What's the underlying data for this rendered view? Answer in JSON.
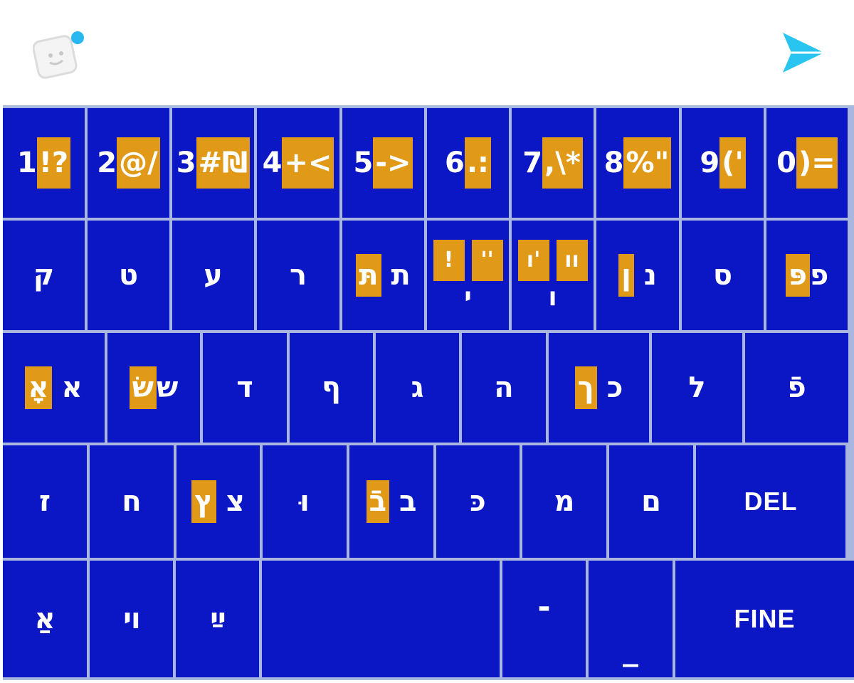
{
  "colors": {
    "key_bg": "#0b16c4",
    "key_text": "#ffffff",
    "highlight": "#e09a17",
    "divider": "#a9b6e0",
    "send": "#29c5f0",
    "badge": "#29b8f0"
  },
  "icons": {
    "emoji": "sticker-face-icon",
    "send": "send-arrow-icon"
  },
  "rows": {
    "numbers": [
      {
        "main": "1",
        "alt": "!?"
      },
      {
        "main": "2",
        "alt": "@/"
      },
      {
        "main": "3",
        "alt": "#₪"
      },
      {
        "main": "4",
        "alt": "+<"
      },
      {
        "main": "5",
        "alt": "->"
      },
      {
        "main": "6",
        "alt": ".:"
      },
      {
        "main": "7",
        "alt": ",\\*"
      },
      {
        "main": "8",
        "alt": "%\""
      },
      {
        "main": "9",
        "alt": "('"
      },
      {
        "main": "0",
        "alt": ")="
      }
    ],
    "row2": [
      {
        "main": "ק"
      },
      {
        "main": "ט"
      },
      {
        "main": "ע"
      },
      {
        "main": "ר"
      },
      {
        "main": "ת",
        "alt": "תּ"
      },
      {
        "alt1": "!",
        "alt2": "''",
        "main": "י"
      },
      {
        "alt1": "ו'",
        "alt2": "וו",
        "main": "ו"
      },
      {
        "main": "נ",
        "alt": "ן"
      },
      {
        "main": "ס"
      },
      {
        "main": "פ",
        "alt": "פּ"
      }
    ],
    "row3": [
      {
        "main": "א",
        "alt": "אָ"
      },
      {
        "main": "ש",
        "alt": "שׂ"
      },
      {
        "main": "ד"
      },
      {
        "main": "ף"
      },
      {
        "main": "ג"
      },
      {
        "main": "ה"
      },
      {
        "main": "כ",
        "alt": "ך"
      },
      {
        "main": "ל"
      },
      {
        "main": "פֿ"
      }
    ],
    "row4": [
      {
        "main": "ז"
      },
      {
        "main": "ח"
      },
      {
        "main": "צ",
        "alt": "ץ"
      },
      {
        "main": "וּ"
      },
      {
        "main": "ב",
        "alt": "בֿ"
      },
      {
        "main": "כּ"
      },
      {
        "main": "מ"
      },
      {
        "main": "ם"
      },
      {
        "main": "DEL"
      }
    ],
    "row5": [
      {
        "main": "אַ"
      },
      {
        "main": "ױ"
      },
      {
        "main": "ײַ"
      },
      {
        "main": ""
      },
      {
        "main": "-"
      },
      {
        "main": "_"
      },
      {
        "main": "FINE"
      }
    ]
  }
}
